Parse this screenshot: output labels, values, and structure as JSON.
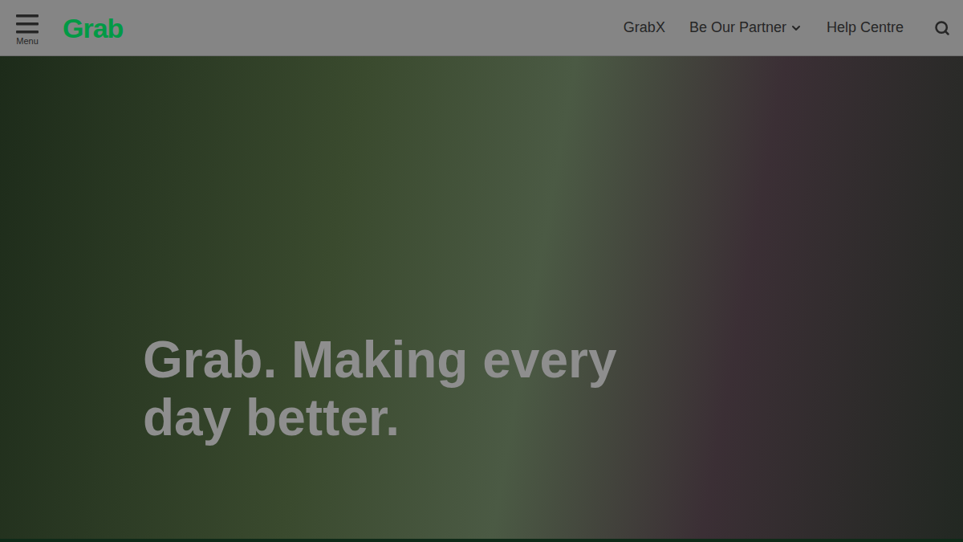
{
  "header": {
    "menu_label": "Menu",
    "logo": "Grab",
    "nav": [
      {
        "label": "GrabX",
        "dropdown": false
      },
      {
        "label": "Be Our Partner",
        "dropdown": true
      },
      {
        "label": "Help Centre",
        "dropdown": false
      }
    ]
  },
  "hero": {
    "heading": "Grab. Making every day better."
  }
}
